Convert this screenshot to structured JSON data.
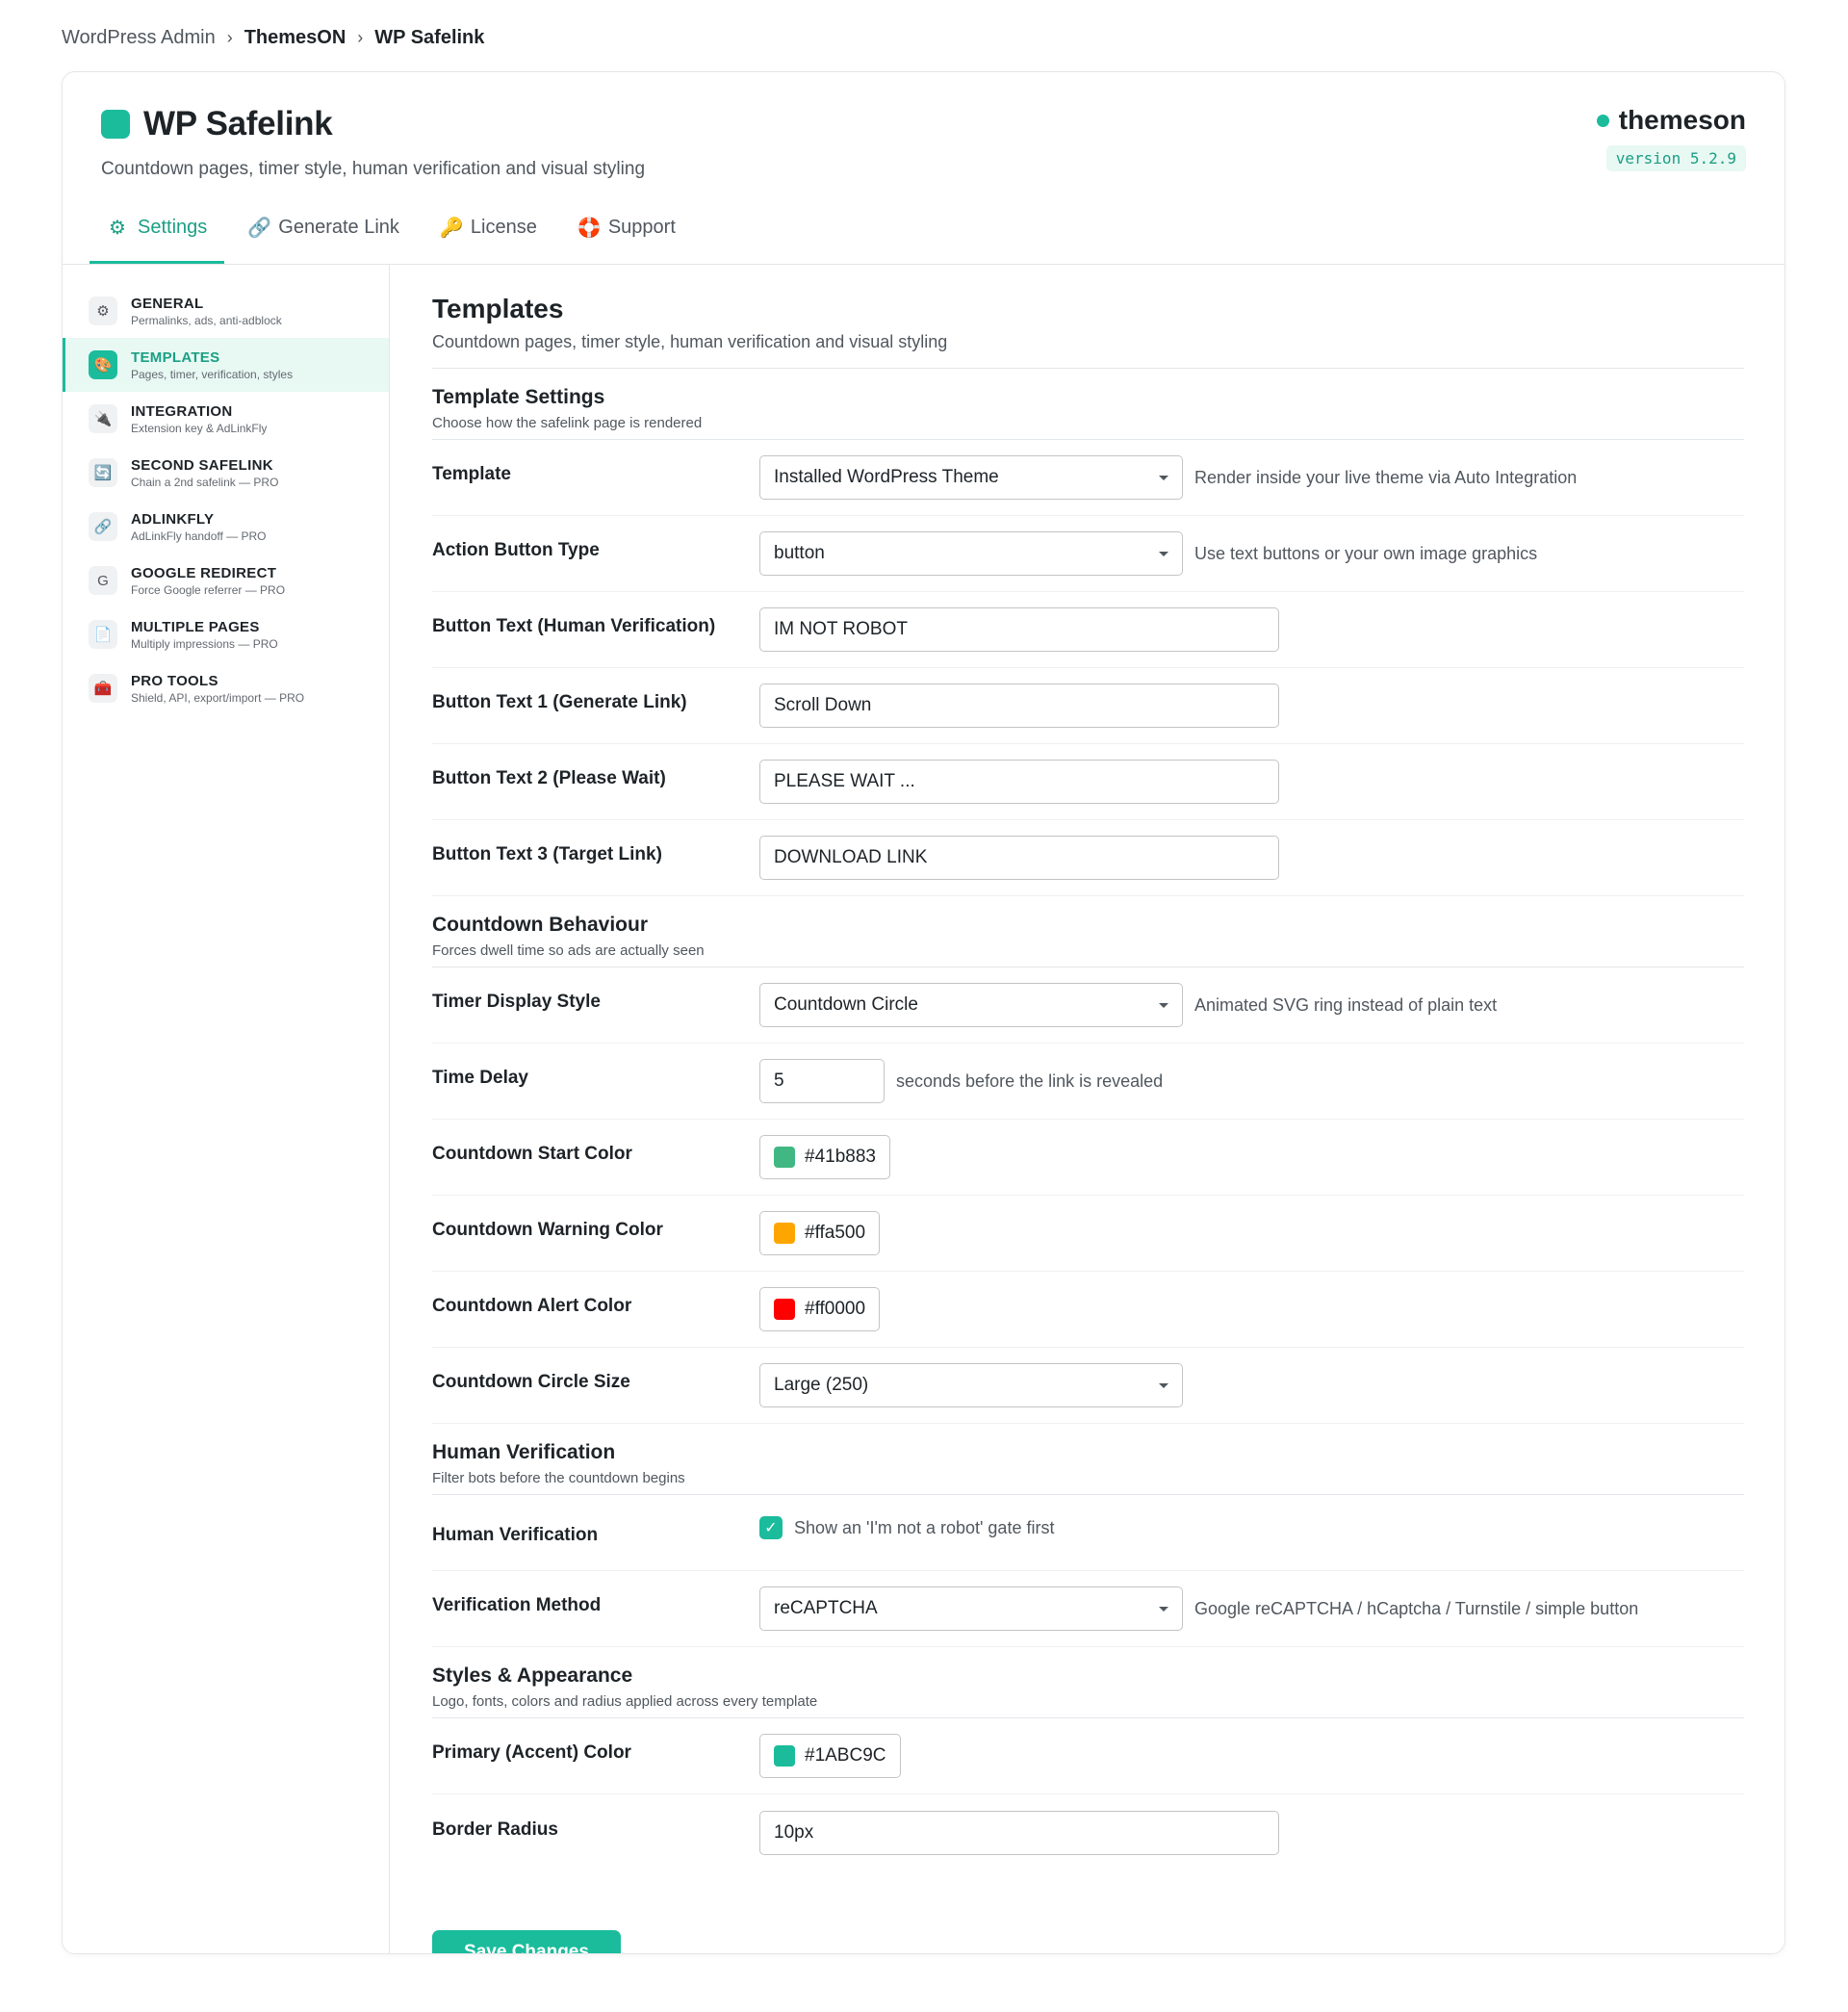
{
  "breadcrumb": {
    "root": "WordPress Admin",
    "mid": "ThemesON",
    "current": "WP Safelink"
  },
  "header": {
    "title": "WP Safelink",
    "subtitle": "Countdown pages, timer style, human verification and visual styling",
    "vendor": "themeson",
    "version": "version 5.2.9"
  },
  "tabs": [
    {
      "label": "Settings",
      "icon": "gear-icon"
    },
    {
      "label": "Generate Link",
      "icon": "link-icon"
    },
    {
      "label": "License",
      "icon": "key-icon"
    },
    {
      "label": "Support",
      "icon": "lifebuoy-icon"
    }
  ],
  "sidebar": {
    "items": [
      {
        "title": "GENERAL",
        "sub": "Permalinks, ads, anti-adblock",
        "icon": "gear-icon"
      },
      {
        "title": "TEMPLATES",
        "sub": "Pages, timer, verification, styles",
        "icon": "palette-icon"
      },
      {
        "title": "INTEGRATION",
        "sub": "Extension key & AdLinkFly",
        "icon": "plug-icon"
      },
      {
        "title": "SECOND SAFELINK",
        "sub": "Chain a 2nd safelink — PRO",
        "icon": "repeat-icon"
      },
      {
        "title": "ADLINKFLY",
        "sub": "AdLinkFly handoff — PRO",
        "icon": "link-icon"
      },
      {
        "title": "GOOGLE REDIRECT",
        "sub": "Force Google referrer — PRO",
        "icon": "google-icon"
      },
      {
        "title": "MULTIPLE PAGES",
        "sub": "Multiply impressions — PRO",
        "icon": "pages-icon"
      },
      {
        "title": "PRO TOOLS",
        "sub": "Shield, API, export/import — PRO",
        "icon": "toolbox-icon"
      }
    ]
  },
  "main": {
    "title": "Templates",
    "subtitle": "Countdown pages, timer style, human verification and visual styling",
    "sections": {
      "template": {
        "title": "Template Settings",
        "sub": "Choose how the safelink page is rendered"
      },
      "countdown": {
        "title": "Countdown Behaviour",
        "sub": "Forces dwell time so ads are actually seen"
      },
      "human": {
        "title": "Human Verification",
        "sub": "Filter bots before the countdown begins"
      },
      "styles": {
        "title": "Styles & Appearance",
        "sub": "Logo, fonts, colors and radius applied across every template"
      }
    },
    "fields": {
      "template": {
        "label": "Template",
        "value": "Installed WordPress Theme",
        "desc": "Render inside your live theme via Auto Integration"
      },
      "action_button_type": {
        "label": "Action Button Type",
        "value": "button",
        "desc": "Use text buttons or your own image graphics"
      },
      "btn_human": {
        "label": "Button Text (Human Verification)",
        "value": "IM NOT ROBOT"
      },
      "btn_1": {
        "label": "Button Text 1 (Generate Link)",
        "value": "Scroll Down"
      },
      "btn_2": {
        "label": "Button Text 2 (Please Wait)",
        "value": "PLEASE WAIT ..."
      },
      "btn_3": {
        "label": "Button Text 3 (Target Link)",
        "value": "DOWNLOAD LINK"
      },
      "timer_style": {
        "label": "Timer Display Style",
        "value": "Countdown Circle",
        "desc": "Animated SVG ring instead of plain text"
      },
      "time_delay": {
        "label": "Time Delay",
        "value": "5",
        "desc": "seconds before the link is revealed"
      },
      "start_color": {
        "label": "Countdown Start Color",
        "value": "#41b883"
      },
      "warning_color": {
        "label": "Countdown Warning Color",
        "value": "#ffa500"
      },
      "alert_color": {
        "label": "Countdown Alert Color",
        "value": "#ff0000"
      },
      "circle_size": {
        "label": "Countdown Circle Size",
        "value": "Large (250)"
      },
      "human_verification": {
        "label": "Human Verification",
        "checked": true,
        "desc": "Show an 'I'm not a robot' gate first"
      },
      "verification_method": {
        "label": "Verification Method",
        "value": "reCAPTCHA",
        "desc": "Google reCAPTCHA / hCaptcha / Turnstile / simple button"
      },
      "primary_color": {
        "label": "Primary (Accent) Color",
        "value": "#1ABC9C"
      },
      "border_radius": {
        "label": "Border Radius",
        "value": "10px"
      }
    },
    "save_label": "Save Changes"
  },
  "colors": {
    "accent": "#1ABC9C",
    "accent_text": "#1a9f84"
  }
}
